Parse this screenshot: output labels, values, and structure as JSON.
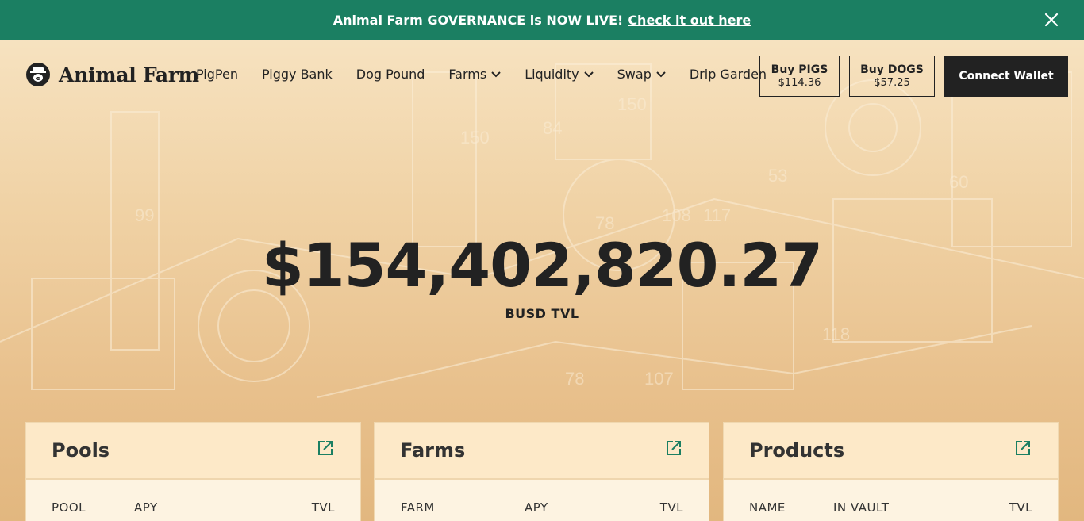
{
  "banner": {
    "text": "Animal Farm GOVERNANCE is NOW LIVE!",
    "link": "Check it out here",
    "close_icon": "close-icon"
  },
  "header": {
    "logo_text": "Animal Farm",
    "logo_icon": "farmer-pig-logo-icon",
    "nav": [
      {
        "label": "PigPen",
        "dropdown": false
      },
      {
        "label": "Piggy Bank",
        "dropdown": false
      },
      {
        "label": "Dog Pound",
        "dropdown": false
      },
      {
        "label": "Farms",
        "dropdown": true
      },
      {
        "label": "Liquidity",
        "dropdown": true
      },
      {
        "label": "Swap",
        "dropdown": true
      },
      {
        "label": "Drip Garden",
        "dropdown": false
      }
    ],
    "buy_pigs": {
      "title": "Buy PIGS",
      "price": "$114.36"
    },
    "buy_dogs": {
      "title": "Buy DOGS",
      "price": "$57.25"
    },
    "connect": "Connect Wallet"
  },
  "hero": {
    "tvl": "$154,402,820.27",
    "label": "BUSD TVL"
  },
  "cards": [
    {
      "title": "Pools",
      "columns": [
        "POOL",
        "APY",
        "TVL"
      ]
    },
    {
      "title": "Farms",
      "columns": [
        "FARM",
        "APY",
        "TVL"
      ]
    },
    {
      "title": "Products",
      "columns": [
        "NAME",
        "IN VAULT",
        "TVL"
      ]
    }
  ],
  "colors": {
    "banner": "#1b7f62",
    "dark": "#222222",
    "card_head": "#fde9c8"
  }
}
